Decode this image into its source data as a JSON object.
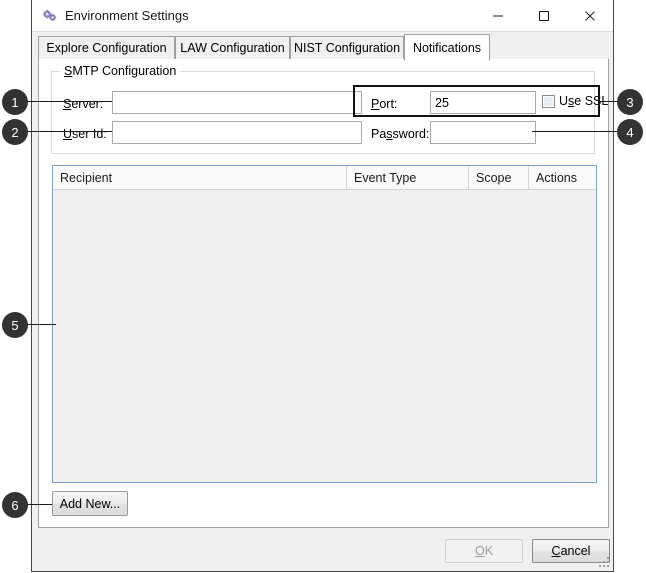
{
  "window": {
    "title": "Environment Settings",
    "icon": "gears-icon",
    "caption_buttons": [
      {
        "name": "minimize",
        "glyph": "minimize-icon"
      },
      {
        "name": "maximize",
        "glyph": "maximize-icon"
      },
      {
        "name": "close",
        "glyph": "close-icon"
      }
    ]
  },
  "tabs": [
    {
      "label": "Explore Configuration",
      "active": false
    },
    {
      "label": "LAW Configuration",
      "active": false
    },
    {
      "label": "NIST Configuration",
      "active": false
    },
    {
      "label": "Notifications",
      "active": true
    }
  ],
  "smtp": {
    "group_title": "SMTP Configuration",
    "group_title_mnemonic": "S",
    "server_label": "Server:",
    "server_mnemonic": "S",
    "server_value": "",
    "userid_label": "User Id:",
    "userid_mnemonic": "U",
    "userid_value": "",
    "port_label": "Port:",
    "port_mnemonic": "P",
    "port_value": "25",
    "password_label": "Password:",
    "password_mnemonic": "s",
    "password_value": "",
    "usessl_label": "Use SSL",
    "usessl_mnemonic": "s",
    "usessl_checked": false
  },
  "grid": {
    "columns": [
      "Recipient",
      "Event Type",
      "Scope",
      "Actions"
    ],
    "rows": []
  },
  "buttons": {
    "add_new": "Add New...",
    "ok": "OK",
    "ok_mnemonic": "O",
    "ok_enabled": false,
    "cancel": "Cancel",
    "cancel_mnemonic": "C",
    "cancel_enabled": true
  },
  "callouts": [
    {
      "number": "1",
      "target": "server-field"
    },
    {
      "number": "2",
      "target": "userid-field"
    },
    {
      "number": "3",
      "target": "port-and-usessl"
    },
    {
      "number": "4",
      "target": "password-field"
    },
    {
      "number": "5",
      "target": "recipients-grid"
    },
    {
      "number": "6",
      "target": "add-new-button"
    }
  ],
  "colors": {
    "badge_fill": "#333333",
    "badge_text": "#ffffff",
    "grid_border": "#7da2ce",
    "dialog_bg": "#f0f0f0"
  }
}
